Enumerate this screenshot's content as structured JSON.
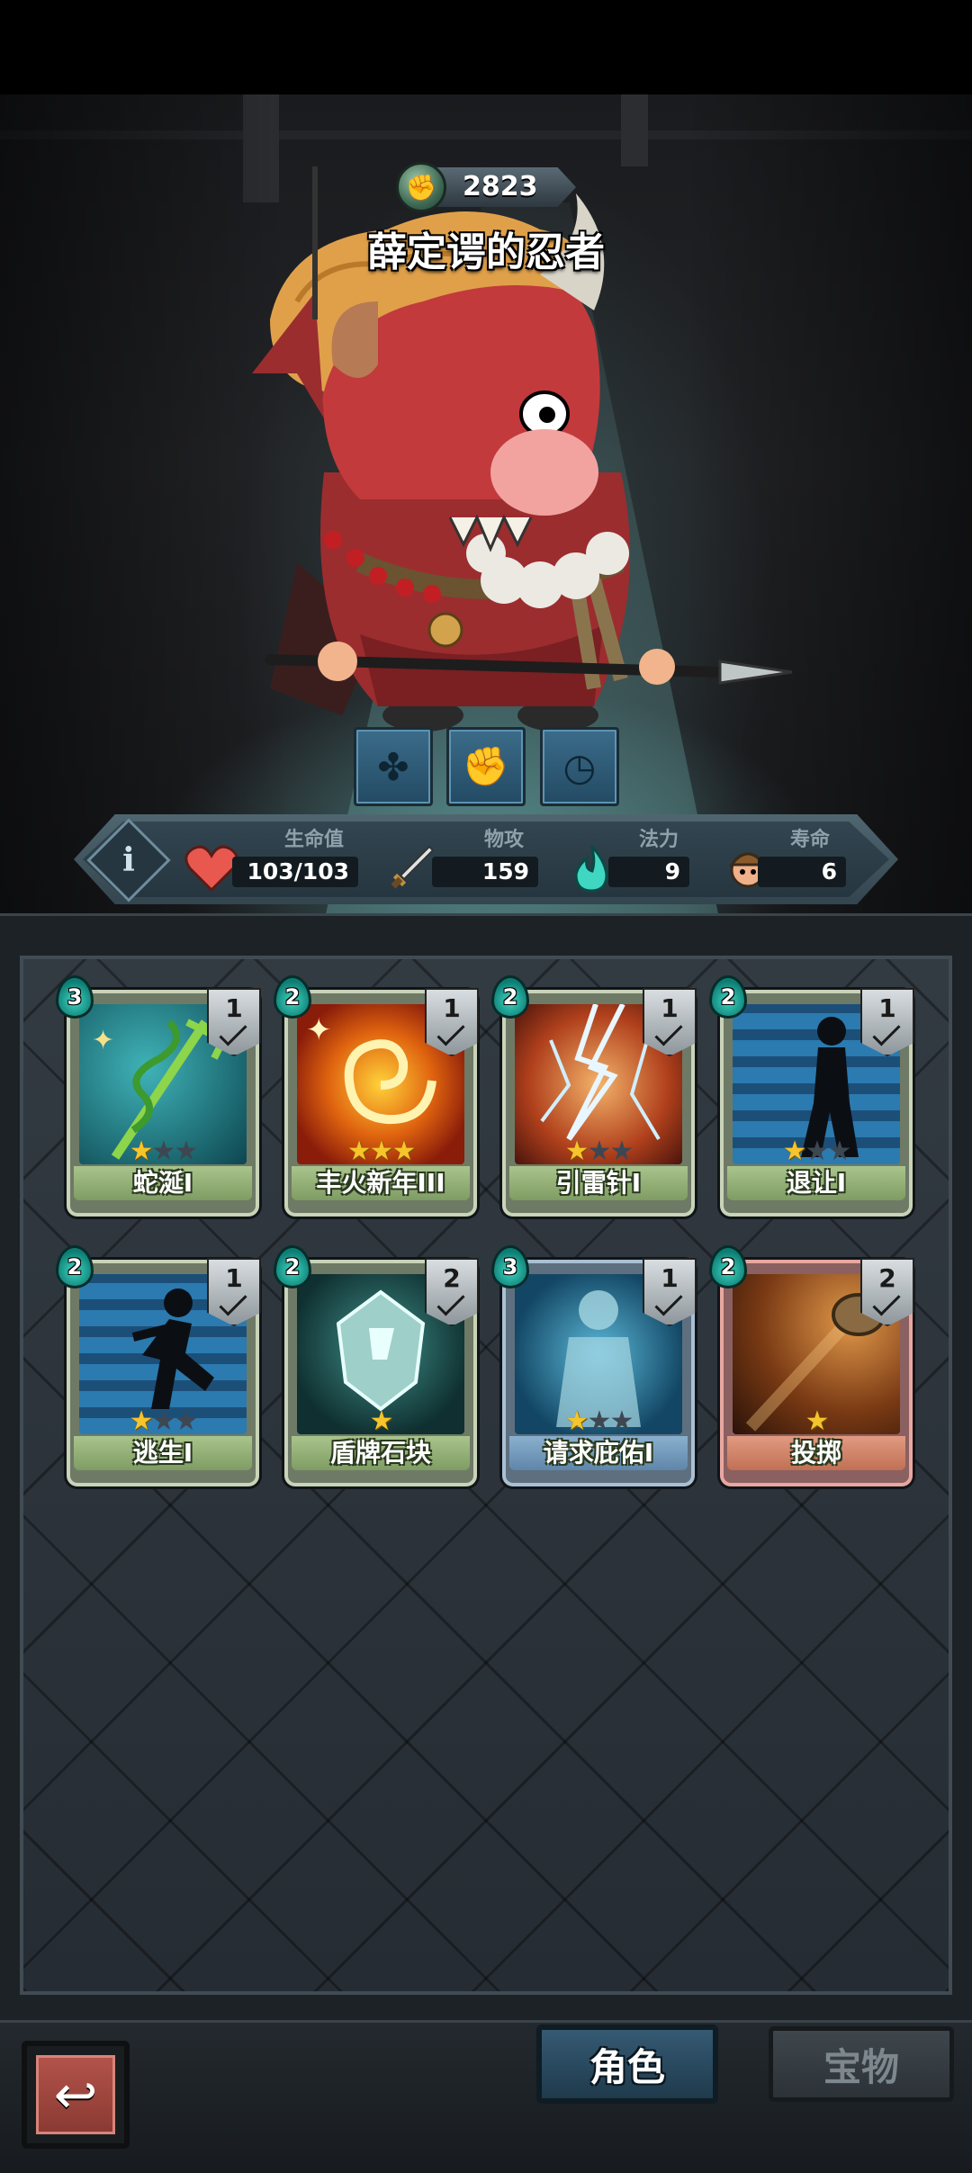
{
  "hero": {
    "souls": "2823",
    "name": "薛定谔的忍者"
  },
  "passive_slots": [
    "clover-rune-icon",
    "fist-rune-icon",
    "clock-rune-icon"
  ],
  "stats": {
    "hp_label": "生命值",
    "hp_value": "103/103",
    "atk_label": "物攻",
    "atk_value": "159",
    "mana_label": "法力",
    "mana_value": "9",
    "life_label": "寿命",
    "life_value": "6"
  },
  "cards": [
    {
      "name": "蛇涎I",
      "cost": "3",
      "level": "1",
      "stars": 1,
      "max_stars": 3,
      "frame": "green",
      "art": "snake-staff"
    },
    {
      "name": "丰火新年III",
      "cost": "2",
      "level": "1",
      "stars": 3,
      "max_stars": 3,
      "frame": "green",
      "art": "fire-swirl"
    },
    {
      "name": "引雷针I",
      "cost": "2",
      "level": "1",
      "stars": 1,
      "max_stars": 3,
      "frame": "green",
      "art": "lightning"
    },
    {
      "name": "退让I",
      "cost": "2",
      "level": "1",
      "stars": 1,
      "max_stars": 3,
      "frame": "green",
      "art": "retreat-silhouette"
    },
    {
      "name": "逃生I",
      "cost": "2",
      "level": "1",
      "stars": 1,
      "max_stars": 3,
      "frame": "green",
      "art": "running-silhouette"
    },
    {
      "name": "盾牌石块",
      "cost": "2",
      "level": "2",
      "stars": 1,
      "max_stars": 1,
      "frame": "green",
      "art": "shield-stone"
    },
    {
      "name": "请求庇佑I",
      "cost": "3",
      "level": "1",
      "stars": 1,
      "max_stars": 3,
      "frame": "blue",
      "art": "spirit-figure"
    },
    {
      "name": "投掷",
      "cost": "2",
      "level": "2",
      "stars": 1,
      "max_stars": 1,
      "frame": "red",
      "art": "thrown-rock"
    }
  ],
  "nav": {
    "back_icon": "return-arrow-icon",
    "role_tab": "角色",
    "treasure_tab": "宝物"
  }
}
